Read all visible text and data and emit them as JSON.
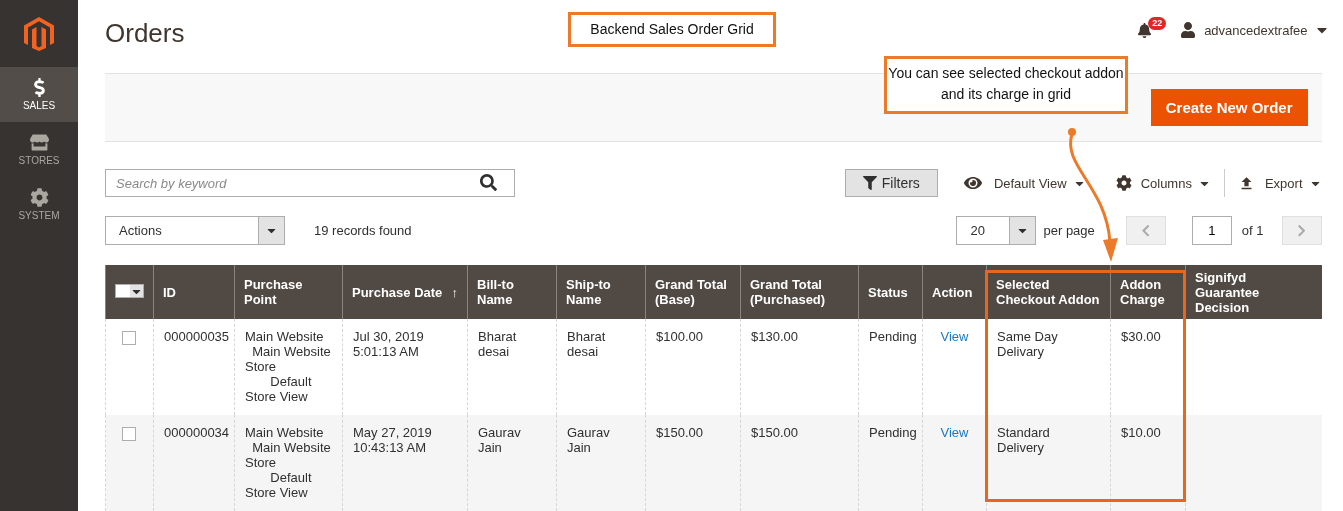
{
  "sidebar": {
    "items": [
      {
        "label": "SALES",
        "selected": true
      },
      {
        "label": "STORES",
        "selected": false
      },
      {
        "label": "SYSTEM",
        "selected": false
      }
    ]
  },
  "header": {
    "title": "Orders",
    "notifications": "22",
    "user": "advancedextrafee"
  },
  "page_actions": {
    "primary_button": "Create New Order"
  },
  "toolbar": {
    "search": {
      "placeholder": "Search by keyword"
    },
    "filters": "Filters",
    "view": "Default View",
    "columns": "Columns",
    "export": "Export"
  },
  "grid_controls": {
    "actions": "Actions",
    "records": "19 records found",
    "per_page_value": "20",
    "per_page_label": "per page",
    "page": "1",
    "of_pages": "of 1"
  },
  "table": {
    "select_all_checked": false,
    "columns": [
      {
        "label": "ID"
      },
      {
        "label": "Purchase Point"
      },
      {
        "label": "Purchase Date",
        "sort": "↑"
      },
      {
        "label": "Bill-to Name"
      },
      {
        "label": "Ship-to Name"
      },
      {
        "label": "Grand Total (Base)"
      },
      {
        "label": "Grand Total (Purchased)"
      },
      {
        "label": "Status"
      },
      {
        "label": "Action"
      },
      {
        "label": "Selected Checkout Addon"
      },
      {
        "label": "Addon Charge"
      },
      {
        "label": "Signifyd Guarantee Decision"
      }
    ],
    "rows": [
      {
        "checked": false,
        "cells": [
          "000000035",
          "Main Website\n  Main Website Store\n       Default Store View",
          "Jul 30, 2019 5:01:13 AM",
          "Bharat desai",
          "Bharat desai",
          "$100.00",
          "$130.00",
          "Pending",
          "View",
          "Same Day Delivary",
          "$30.00",
          ""
        ]
      },
      {
        "checked": false,
        "cells": [
          "000000034",
          "Main Website\n  Main Website Store\n       Default Store View",
          "May 27, 2019 10:43:13 AM",
          "Gaurav Jain",
          "Gaurav Jain",
          "$150.00",
          "$150.00",
          "Pending",
          "View",
          "Standard Delivery",
          "$10.00",
          ""
        ]
      }
    ]
  },
  "annotations": {
    "title": "Backend Sales Order Grid",
    "callout": "You can see selected checkout addon and its charge in grid"
  }
}
